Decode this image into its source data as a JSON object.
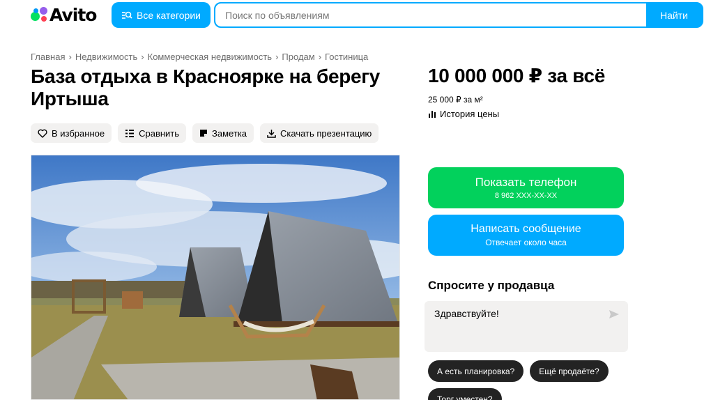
{
  "header": {
    "logo_text": "Avito",
    "categories_button": "Все категории",
    "search_placeholder": "Поиск по объявлениям",
    "search_button": "Найти"
  },
  "breadcrumb": [
    "Главная",
    "Недвижимость",
    "Коммерческая недвижимость",
    "Продам",
    "Гостиница"
  ],
  "breadcrumb_separator": "›",
  "listing": {
    "title": "База отдыха в Красноярке на берегу Иртыша",
    "actions": {
      "favorite": "В избранное",
      "compare": "Сравнить",
      "note": "Заметка",
      "download": "Скачать презентацию"
    }
  },
  "pricing": {
    "price": "10 000 000 ₽ за всё",
    "price_per_m2": "25 000 ₽ за м²",
    "price_history": "История цены"
  },
  "contact": {
    "phone_button": "Показать телефон",
    "phone_number": "8 962 XXX-XX-XX",
    "message_button": "Написать сообщение",
    "message_sub": "Отвечает около часа"
  },
  "ask": {
    "title": "Спросите у продавца",
    "message_value": "Здравствуйте!",
    "chips": [
      "А есть планировка?",
      "Ещё продаёте?",
      "Торг уместен?"
    ]
  },
  "colors": {
    "brand_blue": "#00aaff",
    "phone_green": "#02d15c",
    "chip_dark": "#232323",
    "secondary_bg": "#f2f1f0"
  },
  "icons": {
    "favorite": "heart-icon",
    "compare": "compare-icon",
    "note": "note-icon",
    "download": "download-icon",
    "history": "bar-chart-icon",
    "send": "send-icon",
    "categories": "search-list-icon"
  }
}
